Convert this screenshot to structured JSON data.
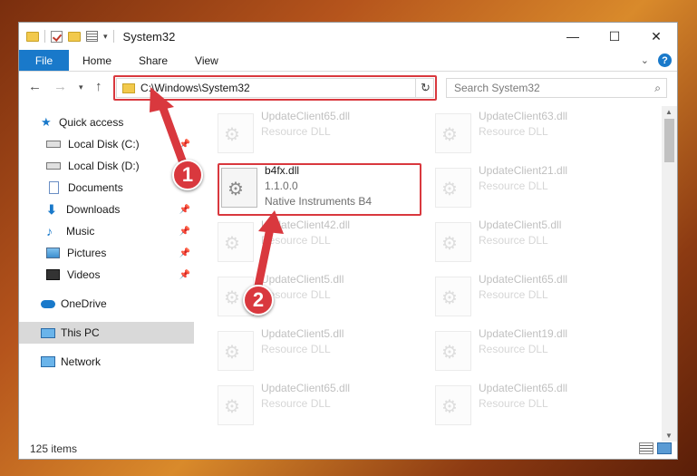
{
  "window": {
    "title": "System32",
    "controls": {
      "minimize": "—",
      "maximize": "☐",
      "close": "✕"
    }
  },
  "ribbon": {
    "tabs": [
      "File",
      "Home",
      "Share",
      "View"
    ],
    "help": "?"
  },
  "nav": {
    "address": "C:\\Windows\\System32",
    "search_placeholder": "Search System32"
  },
  "sidebar": {
    "items": [
      {
        "label": "Quick access",
        "icon": "star-icon"
      },
      {
        "label": "Local Disk (C:)",
        "icon": "disk-icon",
        "pinned": true
      },
      {
        "label": "Local Disk (D:)",
        "icon": "disk-icon"
      },
      {
        "label": "Documents",
        "icon": "documents-icon"
      },
      {
        "label": "Downloads",
        "icon": "download-icon",
        "pinned": true
      },
      {
        "label": "Music",
        "icon": "music-icon",
        "pinned": true
      },
      {
        "label": "Pictures",
        "icon": "pictures-icon",
        "pinned": true
      },
      {
        "label": "Videos",
        "icon": "videos-icon",
        "pinned": true
      },
      {
        "label": "OneDrive",
        "icon": "onedrive-icon"
      },
      {
        "label": "This PC",
        "icon": "pc-icon",
        "selected": true
      },
      {
        "label": "Network",
        "icon": "network-icon"
      }
    ]
  },
  "files": [
    {
      "name": "UpdateClient65.dll",
      "type": "Resource DLL"
    },
    {
      "name": "UpdateClient63.dll",
      "type": "Resource DLL"
    },
    {
      "name": "b4fx.dll",
      "version": "1.1.0.0",
      "company": "Native Instruments B4"
    },
    {
      "name": "UpdateClient21.dll",
      "type": "Resource DLL"
    },
    {
      "name": "UpdateClient42.dll",
      "type": "Resource DLL"
    },
    {
      "name": "UpdateClient5.dll",
      "type": "Resource DLL"
    },
    {
      "name": "UpdateClient5.dll",
      "type": "Resource DLL"
    },
    {
      "name": "UpdateClient65.dll",
      "type": "Resource DLL"
    },
    {
      "name": "UpdateClient5.dll",
      "type": "Resource DLL"
    },
    {
      "name": "UpdateClient19.dll",
      "type": "Resource DLL"
    },
    {
      "name": "UpdateClient65.dll",
      "type": "Resource DLL"
    },
    {
      "name": "UpdateClient65.dll",
      "type": "Resource DLL"
    }
  ],
  "status": {
    "count": "125 items"
  },
  "annotations": {
    "step1": "1",
    "step2": "2",
    "accent": "#d9383e"
  }
}
